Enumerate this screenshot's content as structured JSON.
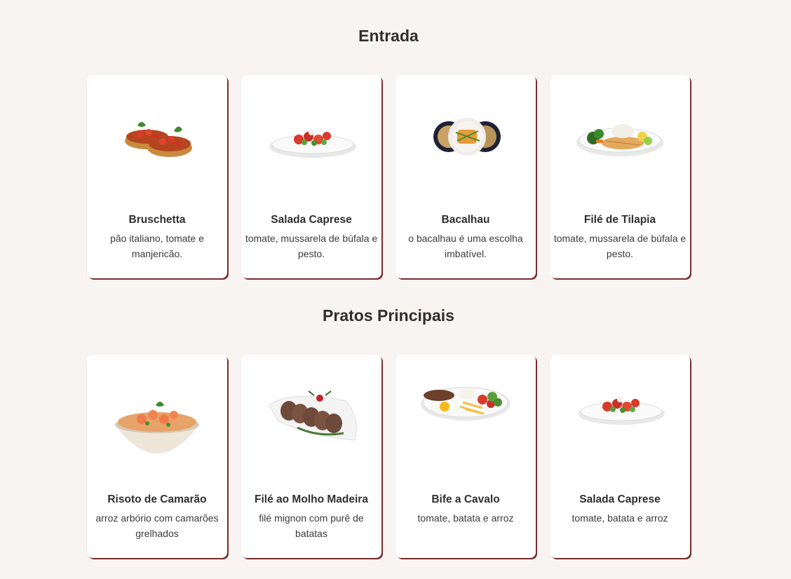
{
  "sections": [
    {
      "title": "Entrada",
      "items": [
        {
          "name": "Bruschetta",
          "desc": "pão italiano, tomate e manjericão.",
          "icon": "bruschetta-image"
        },
        {
          "name": "Salada Caprese",
          "desc": "tomate, mussarela de búfala e pesto.",
          "icon": "salad-plate-image"
        },
        {
          "name": "Bacalhau",
          "desc": "o bacalhau é uma escolha imbatível.",
          "icon": "codfish-bowls-image"
        },
        {
          "name": "Filé de Tilapia",
          "desc": "tomate, mussarela de búfala e pesto.",
          "icon": "tilapia-plate-image"
        }
      ]
    },
    {
      "title": "Pratos Principais",
      "items": [
        {
          "name": "Risoto de Camarão",
          "desc": "arroz arbório com camarões grelhados",
          "icon": "shrimp-risotto-image"
        },
        {
          "name": "Filé ao Molho Madeira",
          "desc": "filé mignon com purê de batatas",
          "icon": "steak-slices-image"
        },
        {
          "name": "Bife a Cavalo",
          "desc": "tomate, batata e arroz",
          "icon": "steak-egg-plate-image"
        },
        {
          "name": "Salada Caprese",
          "desc": "tomate, batata e arroz",
          "icon": "salad-plate-image"
        }
      ]
    }
  ]
}
